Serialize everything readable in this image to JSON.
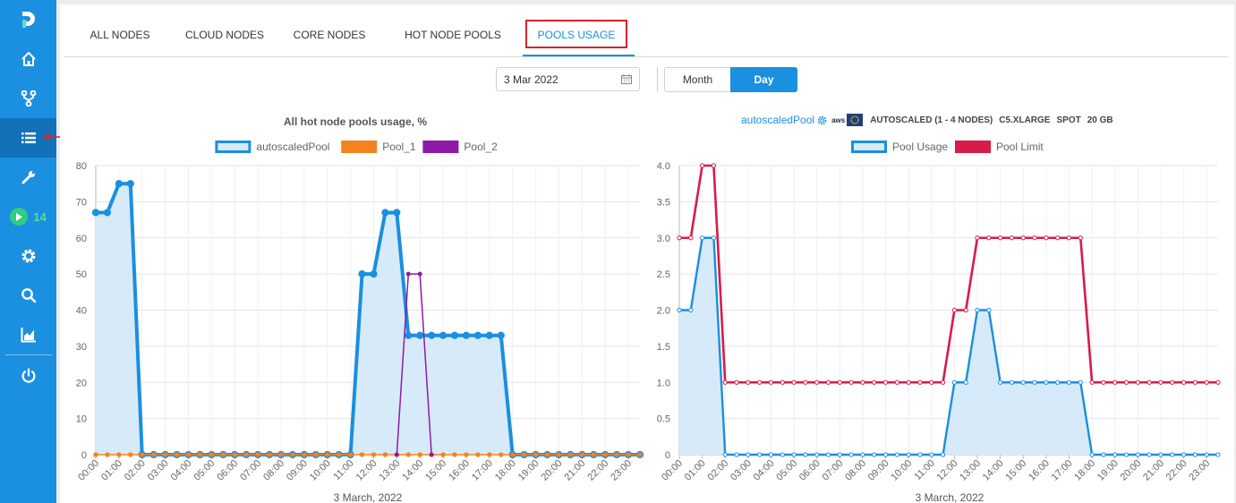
{
  "sidebar": {
    "items": [
      {
        "icon": "logo-icon"
      },
      {
        "icon": "home-icon"
      },
      {
        "icon": "pipeline-icon"
      },
      {
        "icon": "list-icon",
        "active": true
      },
      {
        "icon": "tools-icon"
      },
      {
        "icon": "run-icon",
        "count": "14"
      },
      {
        "icon": "gear-icon"
      },
      {
        "icon": "search-icon"
      },
      {
        "icon": "chart-icon"
      },
      {
        "icon": "power-icon"
      }
    ]
  },
  "tabs": [
    {
      "label": "ALL NODES"
    },
    {
      "label": "CLOUD NODES"
    },
    {
      "label": "CORE NODES"
    },
    {
      "label": "HOT NODE POOLS"
    },
    {
      "label": "POOLS USAGE",
      "active": true
    }
  ],
  "date_filter": {
    "value": "3 Mar 2022"
  },
  "period": {
    "month": "Month",
    "day": "Day",
    "selected": "Day"
  },
  "right_info": {
    "pool_name": "autoscaledPool",
    "provider": "aws",
    "autoscaled": "AUTOSCALED (1 - 4 NODES)",
    "instance": "C5.XLARGE",
    "spot": "SPOT",
    "disk": "20 GB"
  },
  "colors": {
    "accent": "#1b8fe0",
    "pool1": "#f5821f",
    "pool2": "#8e1aa8",
    "limit": "#d81b4a",
    "area": "#d7eaf9"
  },
  "chart_data": [
    {
      "type": "line",
      "title": "All hot node pools usage, %",
      "xlabel": "3 March, 2022",
      "ylabel": "",
      "ylim": [
        0,
        80
      ],
      "yticks": [
        "0",
        "10",
        "20",
        "30",
        "40",
        "50",
        "60",
        "70",
        "80"
      ],
      "hour_labels": [
        "00:00",
        "01:00",
        "02:00",
        "03:00",
        "04:00",
        "05:00",
        "06:00",
        "07:00",
        "08:00",
        "09:00",
        "10:00",
        "11:00",
        "12:00",
        "13:00",
        "14:00",
        "15:00",
        "16:00",
        "17:00",
        "18:00",
        "19:00",
        "20:00",
        "21:00",
        "22:00",
        "23:00"
      ],
      "x": [
        0,
        0.5,
        1,
        1.5,
        2,
        2.5,
        3,
        3.5,
        4,
        4.5,
        5,
        5.5,
        6,
        6.5,
        7,
        7.5,
        8,
        8.5,
        9,
        9.5,
        10,
        10.5,
        11,
        11.5,
        12,
        12.5,
        13,
        13.5,
        14,
        14.5,
        15,
        15.5,
        16,
        16.5,
        17,
        17.5,
        18,
        18.5,
        19,
        19.5,
        20,
        20.5,
        21,
        21.5,
        22,
        22.5,
        23,
        23.5
      ],
      "legend_position": "top",
      "series": [
        {
          "name": "autoscaledPool",
          "values": [
            67,
            67,
            75,
            75,
            0,
            0,
            0,
            0,
            0,
            0,
            0,
            0,
            0,
            0,
            0,
            0,
            0,
            0,
            0,
            0,
            0,
            0,
            0,
            50,
            50,
            67,
            67,
            33,
            33,
            33,
            33,
            33,
            33,
            33,
            33,
            33,
            0,
            0,
            0,
            0,
            0,
            0,
            0,
            0,
            0,
            0,
            0,
            0
          ]
        },
        {
          "name": "Pool_1",
          "values": [
            0,
            0,
            0,
            0,
            0,
            0,
            0,
            0,
            0,
            0,
            0,
            0,
            0,
            0,
            0,
            0,
            0,
            0,
            0,
            0,
            0,
            0,
            0,
            0,
            0,
            0,
            0,
            0,
            0,
            0,
            0,
            0,
            0,
            0,
            0,
            0,
            0,
            0,
            0,
            0,
            0,
            0,
            0,
            0,
            0,
            0,
            0,
            0
          ]
        },
        {
          "name": "Pool_2",
          "values": [
            null,
            null,
            null,
            null,
            null,
            null,
            null,
            null,
            null,
            null,
            null,
            null,
            null,
            null,
            null,
            null,
            null,
            null,
            null,
            null,
            null,
            null,
            null,
            null,
            null,
            null,
            0,
            50,
            50,
            0,
            null,
            null,
            null,
            null,
            null,
            null,
            null,
            null,
            null,
            null,
            null,
            null,
            null,
            null,
            null,
            null,
            null,
            null
          ]
        }
      ]
    },
    {
      "type": "line",
      "title": "",
      "xlabel": "3 March, 2022",
      "ylabel": "",
      "ylim": [
        0,
        4
      ],
      "yticks": [
        "0",
        "0.5",
        "1.0",
        "1.5",
        "2.0",
        "2.5",
        "3.0",
        "3.5",
        "4.0"
      ],
      "hour_labels": [
        "00:00",
        "01:00",
        "02:00",
        "03:00",
        "04:00",
        "05:00",
        "06:00",
        "07:00",
        "08:00",
        "09:00",
        "10:00",
        "11:00",
        "12:00",
        "13:00",
        "14:00",
        "15:00",
        "16:00",
        "17:00",
        "18:00",
        "19:00",
        "20:00",
        "21:00",
        "22:00",
        "23:00"
      ],
      "x": [
        0,
        0.5,
        1,
        1.5,
        2,
        2.5,
        3,
        3.5,
        4,
        4.5,
        5,
        5.5,
        6,
        6.5,
        7,
        7.5,
        8,
        8.5,
        9,
        9.5,
        10,
        10.5,
        11,
        11.5,
        12,
        12.5,
        13,
        13.5,
        14,
        14.5,
        15,
        15.5,
        16,
        16.5,
        17,
        17.5,
        18,
        18.5,
        19,
        19.5,
        20,
        20.5,
        21,
        21.5,
        22,
        22.5,
        23,
        23.5
      ],
      "legend_position": "top",
      "series": [
        {
          "name": "Pool Usage",
          "values": [
            2,
            2,
            3,
            3,
            0,
            0,
            0,
            0,
            0,
            0,
            0,
            0,
            0,
            0,
            0,
            0,
            0,
            0,
            0,
            0,
            0,
            0,
            0,
            0,
            1,
            1,
            2,
            2,
            1,
            1,
            1,
            1,
            1,
            1,
            1,
            1,
            0,
            0,
            0,
            0,
            0,
            0,
            0,
            0,
            0,
            0,
            0,
            0
          ]
        },
        {
          "name": "Pool Limit",
          "values": [
            3,
            3,
            4,
            4,
            1,
            1,
            1,
            1,
            1,
            1,
            1,
            1,
            1,
            1,
            1,
            1,
            1,
            1,
            1,
            1,
            1,
            1,
            1,
            1,
            2,
            2,
            3,
            3,
            3,
            3,
            3,
            3,
            3,
            3,
            3,
            3,
            1,
            1,
            1,
            1,
            1,
            1,
            1,
            1,
            1,
            1,
            1,
            1
          ]
        }
      ]
    }
  ]
}
